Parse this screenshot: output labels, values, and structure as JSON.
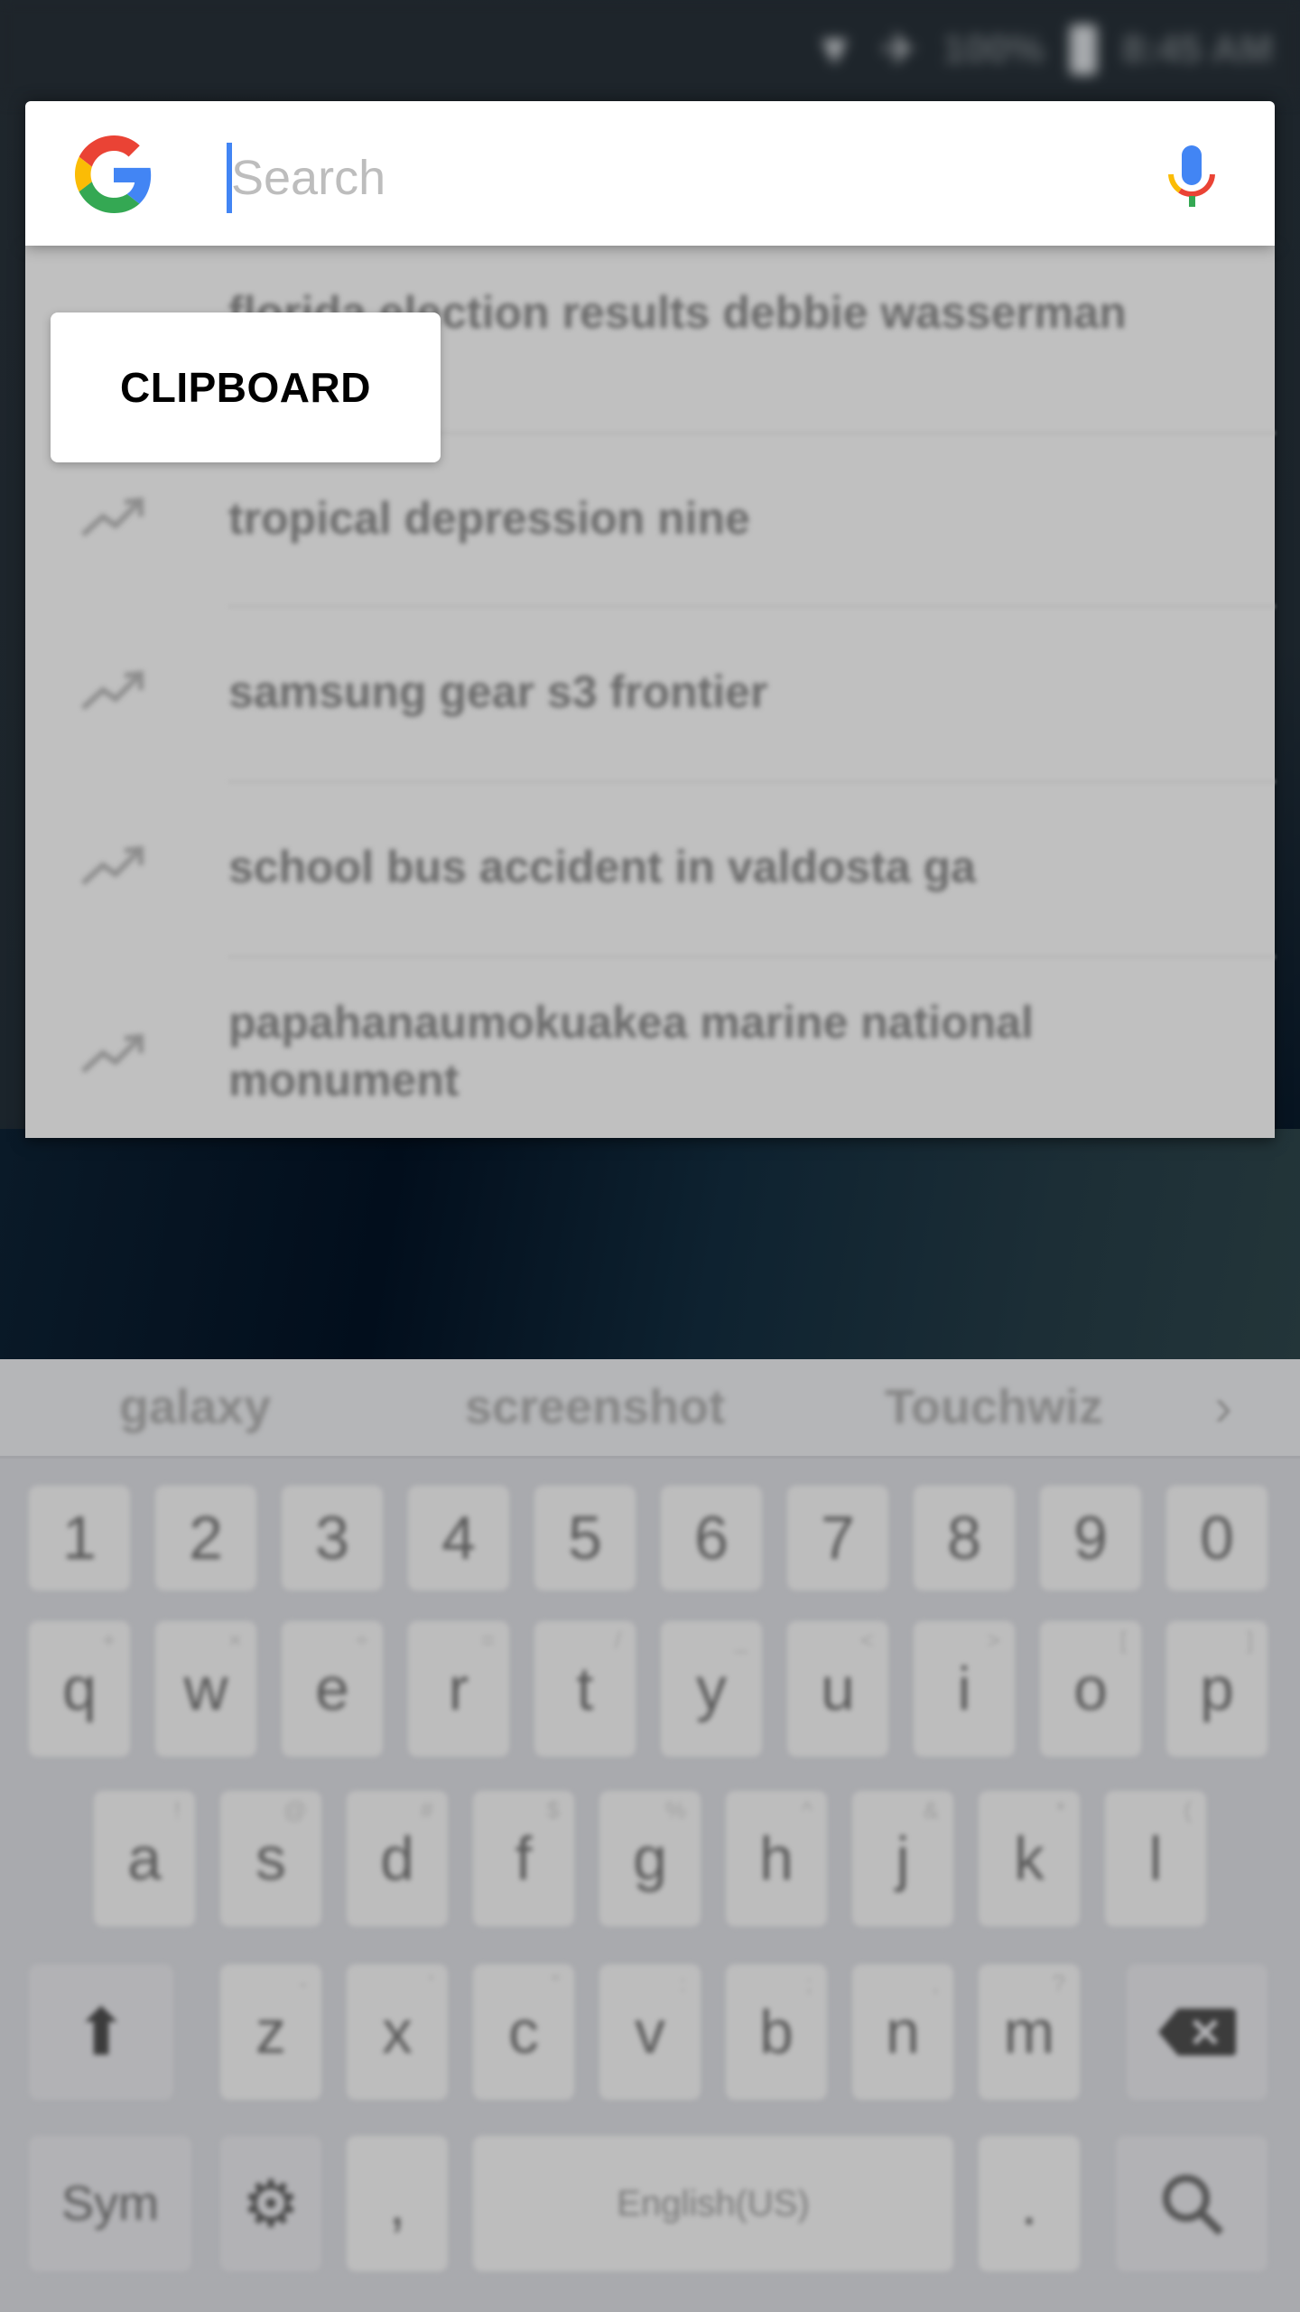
{
  "status_bar": {
    "wifi_icon": "wifi-icon",
    "airplane_icon": "airplane-icon",
    "battery_percent": "100%",
    "battery_icon": "battery-icon",
    "time": "8:45 AM"
  },
  "search": {
    "logo": "google-g-logo",
    "placeholder": "Search",
    "value": "",
    "mic_icon": "mic-icon",
    "brand_colors": {
      "blue": "#4285F4",
      "red": "#EA4335",
      "yellow": "#FBBC05",
      "green": "#34A853"
    }
  },
  "clipboard_popup": {
    "label": "CLIPBOARD"
  },
  "suggestions": [
    {
      "text": "florida election results debbie wasserman",
      "icon": ""
    },
    {
      "text": "tropical depression nine",
      "icon": "trending-icon"
    },
    {
      "text": "samsung gear s3 frontier",
      "icon": "trending-icon"
    },
    {
      "text": "school bus accident in valdosta ga",
      "icon": "trending-icon"
    },
    {
      "text": "papahanaumokuakea marine national monument",
      "icon": "trending-icon"
    }
  ],
  "keyboard": {
    "predictions": [
      "galaxy",
      "screenshot",
      "Touchwiz"
    ],
    "predictions_more_icon": "chevron-right-icon",
    "number_row": [
      "1",
      "2",
      "3",
      "4",
      "5",
      "6",
      "7",
      "8",
      "9",
      "0"
    ],
    "row1": [
      "q",
      "w",
      "e",
      "r",
      "t",
      "y",
      "u",
      "i",
      "o",
      "p"
    ],
    "row1_hints": [
      "+",
      "×",
      "÷",
      "=",
      "/",
      "_",
      "<",
      ">",
      "[",
      "]"
    ],
    "row2": [
      "a",
      "s",
      "d",
      "f",
      "g",
      "h",
      "j",
      "k",
      "l"
    ],
    "row2_hints": [
      "!",
      "@",
      "#",
      "$",
      "%",
      "^",
      "&",
      "*",
      "("
    ],
    "row3": [
      "z",
      "x",
      "c",
      "v",
      "b",
      "n",
      "m"
    ],
    "row3_hints": [
      "-",
      "'",
      "\"",
      ":",
      ";",
      ",",
      "?"
    ],
    "shift_icon": "shift-icon",
    "backspace_icon": "backspace-icon",
    "sym_label": "Sym",
    "settings_icon": "gear-icon",
    "comma": ",",
    "space_label": "English(US)",
    "period": ".",
    "search_icon": "search-icon"
  }
}
